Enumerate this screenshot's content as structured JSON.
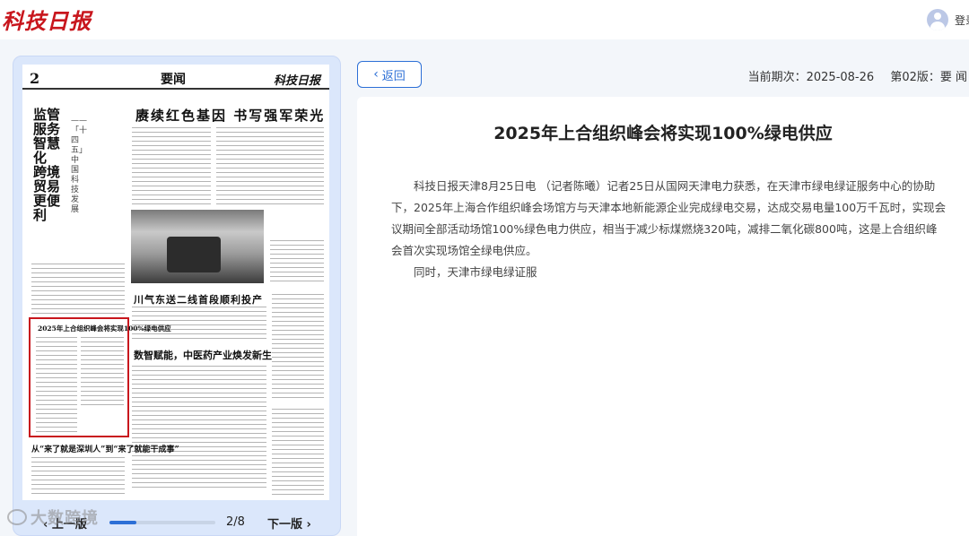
{
  "header": {
    "logo_text": "科技日报",
    "login_label": "登录"
  },
  "paper": {
    "page_no": "2",
    "section": "要闻",
    "masthead": "科技日报",
    "vertical_headline": "监管服务智慧化 跨境贸易更便利",
    "vertical_sub": "——「十四五」中国科技发展",
    "headline_1": "赓续红色基因 书写强军荣光",
    "headline_2": "川气东送二线首段顺利投产",
    "headline_3": "数智赋能，中医药产业焕发新生",
    "highlight_title": "2025年上合组织峰会将实现100%绿电供应",
    "small_headline": "从“来了就是深圳人”到“来了就能干成事”"
  },
  "pager": {
    "prev_label": "‹ 上一版",
    "next_label": "下一版 ›",
    "current": 2,
    "total": 8,
    "count_text": "2/8",
    "progress_fraction": 0.25
  },
  "watermark": {
    "text": "大数跨境"
  },
  "article_header": {
    "back_label": "返回",
    "issue_label": "当前期次：2025-08-26",
    "edition_label": "第02版：要 闻"
  },
  "article": {
    "title": "2025年上合组织峰会将实现100%绿电供应",
    "paragraphs": [
      "科技日报天津8月25日电 （记者陈曦）记者25日从国网天津电力获悉，在天津市绿电绿证服务中心的协助下，2025年上海合作组织峰会场馆方与天津本地新能源企业完成绿电交易，达成交易电量100万千瓦时，实现会议期间全部活动场馆100%绿色电力供应，相当于减少标煤燃烧320吨，减排二氧化碳800吨，这是上合组织峰会首次实现场馆全绿电供应。",
      "同时，天津市绿电绿证服"
    ]
  },
  "colors": {
    "brand_red": "#c8161d",
    "accent_blue": "#2c6fd6",
    "panel_bg": "#dbe7fb"
  }
}
